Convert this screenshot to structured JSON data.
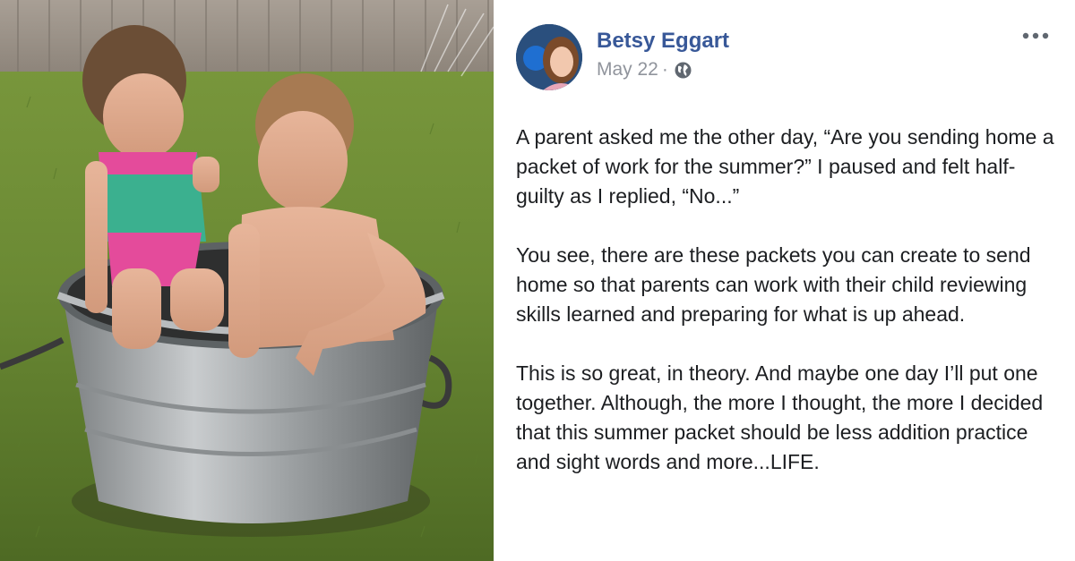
{
  "post": {
    "author": "Betsy Eggart",
    "date": "May 22",
    "separator": "·",
    "privacy_icon": "globe-icon",
    "more_icon": "more-options-icon",
    "paragraphs": [
      "A parent asked me the other day, “Are you sending home a packet of work for the summer?” I paused and felt half-guilty as I replied, “No...”",
      "You see, there are these packets you can create to send home so that parents can work with their child reviewing skills learned and preparing for what is up ahead.",
      "This is so great, in theory. And maybe one day I’ll put one together. Although, the more I thought, the more I decided that this summer packet should be less addition practice and sight words and more...LIFE."
    ]
  },
  "photo": {
    "description_icon": "photo-kids-in-tub"
  },
  "colors": {
    "author_link": "#385898",
    "meta_text": "#90949c",
    "body_text": "#1c1e21"
  }
}
